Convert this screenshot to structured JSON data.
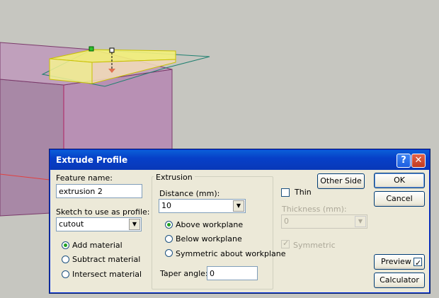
{
  "dialog": {
    "title": "Extrude Profile",
    "feature_name_label": "Feature name:",
    "feature_name_value": "extrusion 2",
    "sketch_label": "Sketch to use as profile:",
    "sketch_value": "cutout",
    "material_options": [
      "Add material",
      "Subtract material",
      "Intersect material"
    ],
    "material_selected": "Add material",
    "extrusion_group_title": "Extrusion",
    "distance_label": "Distance (mm):",
    "distance_value": "10",
    "workplane_options": [
      "Above workplane",
      "Below workplane",
      "Symmetric about workplane"
    ],
    "workplane_selected": "Above workplane",
    "taper_label": "Taper angle:",
    "taper_value": "0",
    "other_side_label": "Other Side",
    "thin_label": "Thin",
    "thin_checked": false,
    "thickness_label": "Thickness (mm):",
    "thickness_value": "0",
    "symmetric_label": "Symmetric",
    "symmetric_checked": true,
    "ok_label": "OK",
    "cancel_label": "Cancel",
    "preview_label": "Preview",
    "preview_checked": true,
    "calculator_label": "Calculator",
    "help_glyph": "?",
    "close_glyph": "✕"
  },
  "colors": {
    "titlebar": "#0a5fd8",
    "dialog_bg": "#ece9d8",
    "solid_face": "#b084a6",
    "preview_body": "#f7f47c",
    "viewport_bg": "#c6c6c0"
  }
}
